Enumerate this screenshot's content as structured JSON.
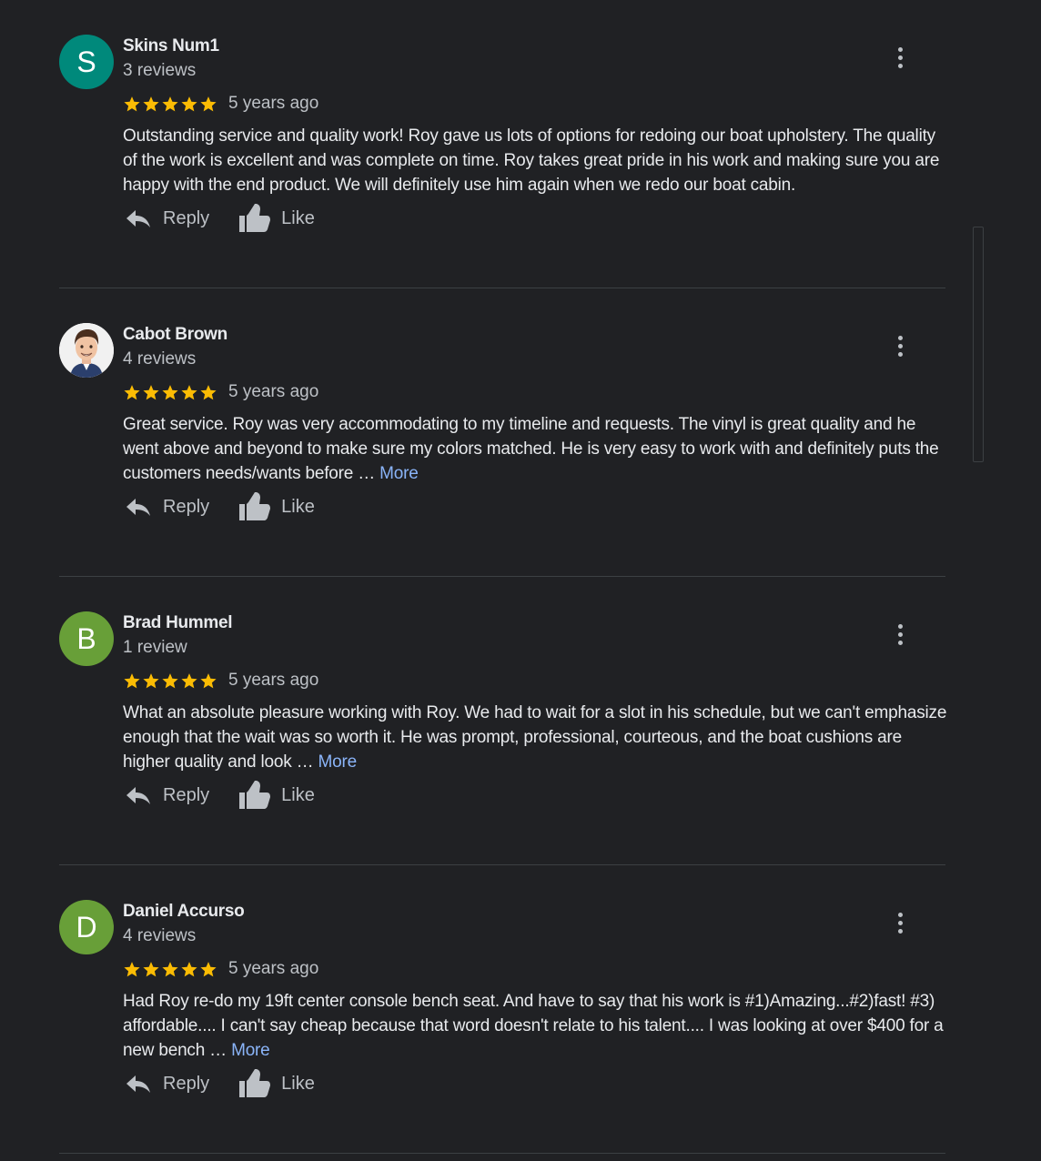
{
  "reviews": [
    {
      "author": "Skins Num1",
      "initial": "S",
      "avatar_color": "#00897b",
      "review_count": "3 reviews",
      "rating": 5,
      "time": "5 years ago",
      "text": "Outstanding service and quality work!  Roy gave us lots of options for redoing our boat upholstery. The quality of the work is excellent and was complete on time. Roy takes great pride in his work and making sure you are happy with the end product. We will definitely use him again when we redo our boat cabin.",
      "more": "",
      "reply_label": "Reply",
      "like_label": "Like"
    },
    {
      "author": "Cabot Brown",
      "initial": "",
      "avatar_color": "#ffffff",
      "review_count": "4 reviews",
      "rating": 5,
      "time": "5 years ago",
      "text": "Great service. Roy was very accommodating to my timeline and requests. The vinyl is great quality and he went above and beyond to make sure my colors matched. He is very easy to work with and definitely puts the customers needs/wants before … ",
      "more": "More",
      "reply_label": "Reply",
      "like_label": "Like"
    },
    {
      "author": "Brad Hummel",
      "initial": "B",
      "avatar_color": "#689f38",
      "review_count": "1 review",
      "rating": 5,
      "time": "5 years ago",
      "text": "What an absolute pleasure working with Roy.  We had to wait for a slot in his schedule, but we can't emphasize enough that the wait was so worth it.  He was prompt, professional, courteous, and the boat cushions are higher quality and look … ",
      "more": "More",
      "reply_label": "Reply",
      "like_label": "Like"
    },
    {
      "author": "Daniel Accurso",
      "initial": "D",
      "avatar_color": "#689f38",
      "review_count": "4 reviews",
      "rating": 5,
      "time": "5 years ago",
      "text": "Had Roy re-do my 19ft center console bench seat. And have to say that his work is #1)Amazing...#2)fast! #3) affordable.... I can't say cheap because that word doesn't relate to his talent.... I was looking at over $400 for a new bench … ",
      "more": "More",
      "reply_label": "Reply",
      "like_label": "Like"
    }
  ],
  "colors": {
    "background": "#202124",
    "star": "#fbbc04",
    "link": "#8ab4f8",
    "divider": "#3c4043"
  },
  "icons": {
    "reply": "reply-icon",
    "like": "thumbs-up-icon",
    "menu": "more-vert-icon",
    "star": "star-icon"
  }
}
